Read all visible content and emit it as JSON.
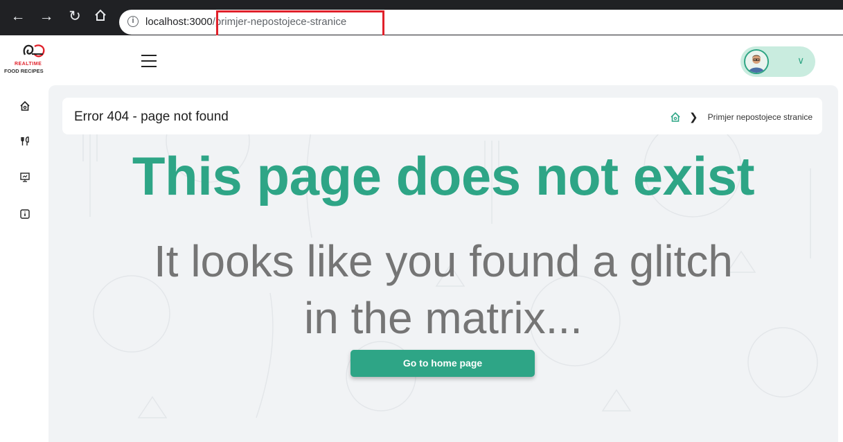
{
  "browser": {
    "url_host": "localhost:3000",
    "url_path": "/primjer-nepostojece-stranice",
    "icons": [
      "back-arrow-icon",
      "forward-arrow-icon",
      "reload-icon",
      "home-icon",
      "info-icon"
    ]
  },
  "header": {
    "logo_line1": "REALTIME",
    "logo_line2": "FOOD RECIPES",
    "menu_icon": "hamburger-icon",
    "profile_icon": "avatar",
    "dropdown_icon": "chevron-down-icon"
  },
  "sidebar": {
    "items": [
      {
        "icon": "home-icon"
      },
      {
        "icon": "fork-knife-icon"
      },
      {
        "icon": "presentation-chart-icon"
      },
      {
        "icon": "info-square-icon"
      }
    ]
  },
  "page": {
    "title": "Error 404 - page not found",
    "breadcrumb_current": "Primjer nepostojece stranice",
    "headline": "This page does not exist",
    "subline_1": "It looks like you found a glitch",
    "subline_2": "in the matrix...",
    "button_label": "Go to home page"
  },
  "colors": {
    "accent": "#2ea586",
    "highlight": "#e0202a",
    "chrome": "#202124",
    "background": "#f1f3f5"
  }
}
